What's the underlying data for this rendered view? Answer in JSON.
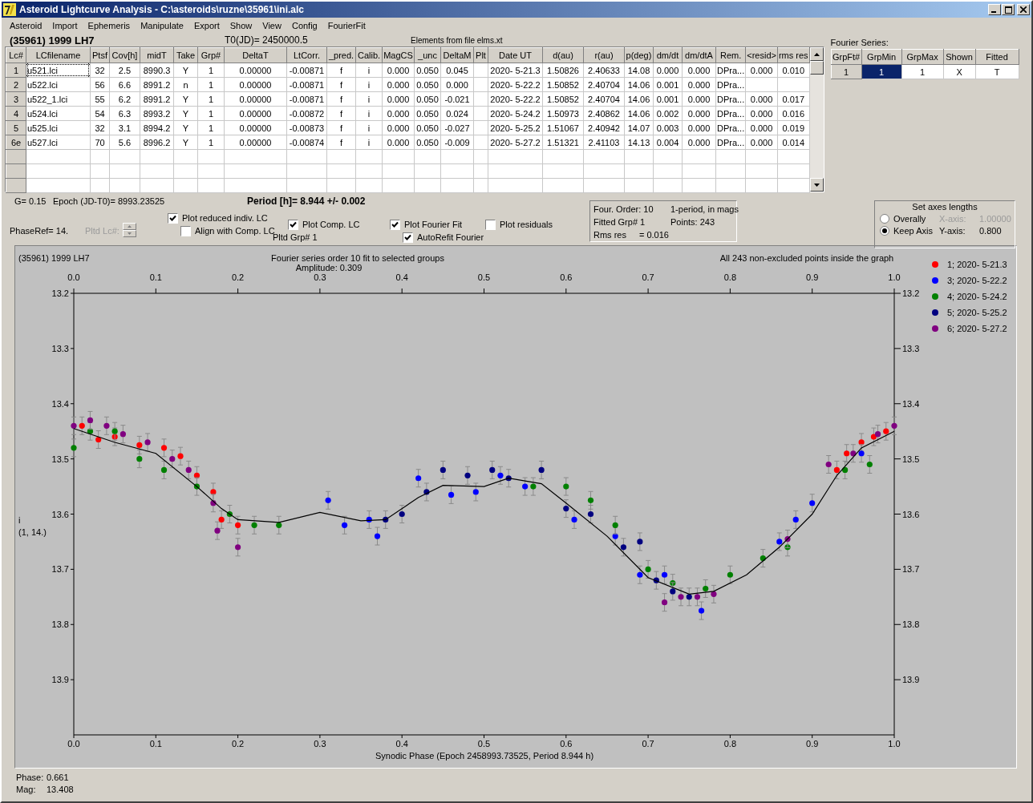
{
  "window": {
    "title": "Asteroid Lightcurve Analysis - C:\\asteroids\\ruzne\\35961\\ini.alc"
  },
  "menu": [
    "Asteroid",
    "Import",
    "Ephemeris",
    "Manipulate",
    "Export",
    "Show",
    "View",
    "Config",
    "FourierFit"
  ],
  "header": {
    "object": "(35961) 1999 LH7",
    "t0": "T0(JD)= 2450000.5",
    "elements": "Elements from file elms.xt"
  },
  "table": {
    "columns": [
      "Lc#",
      "LCfilename",
      "Ptsf",
      "Cov[h]",
      "midT",
      "Take",
      "Grp#",
      "DeltaT",
      "LtCorr.",
      "_pred.",
      "Calib.",
      "MagCS",
      "_unc",
      "DeltaM",
      "Plt",
      "Date UT",
      "d(au)",
      "r(au)",
      "p(deg)",
      "dm/dt",
      "dm/dtA",
      "Rem.",
      "<resid>",
      "rms res"
    ],
    "rows": [
      {
        "cells": [
          "1",
          "u521.lci",
          "32",
          "2.5",
          "8990.3",
          "Y",
          "1",
          "0.00000",
          "-0.00871",
          "f",
          "i",
          "0.000",
          "0.050",
          "0.045",
          null,
          "2020- 5-21.3",
          "1.50826",
          "2.40633",
          "14.08",
          "0.000",
          "0.000",
          "DPra...",
          "0.000",
          "0.010"
        ],
        "focused": true
      },
      {
        "cells": [
          "2",
          "u522.lci",
          "56",
          "6.6",
          "8991.2",
          "n",
          "1",
          "0.00000",
          "-0.00871",
          "f",
          "i",
          "0.000",
          "0.050",
          "0.000",
          null,
          "2020- 5-22.2",
          "1.50852",
          "2.40704",
          "14.06",
          "0.001",
          "0.000",
          "DPra...",
          null,
          null
        ],
        "focused": false
      },
      {
        "cells": [
          "3",
          "u522_1.lci",
          "55",
          "6.2",
          "8991.2",
          "Y",
          "1",
          "0.00000",
          "-0.00871",
          "f",
          "i",
          "0.000",
          "0.050",
          "-0.021",
          null,
          "2020- 5-22.2",
          "1.50852",
          "2.40704",
          "14.06",
          "0.001",
          "0.000",
          "DPra...",
          "0.000",
          "0.017"
        ],
        "focused": false
      },
      {
        "cells": [
          "4",
          "u524.lci",
          "54",
          "6.3",
          "8993.2",
          "Y",
          "1",
          "0.00000",
          "-0.00872",
          "f",
          "i",
          "0.000",
          "0.050",
          "0.024",
          null,
          "2020- 5-24.2",
          "1.50973",
          "2.40862",
          "14.06",
          "0.002",
          "0.000",
          "DPra...",
          "0.000",
          "0.016"
        ],
        "focused": false
      },
      {
        "cells": [
          "5",
          "u525.lci",
          "32",
          "3.1",
          "8994.2",
          "Y",
          "1",
          "0.00000",
          "-0.00873",
          "f",
          "i",
          "0.000",
          "0.050",
          "-0.027",
          null,
          "2020- 5-25.2",
          "1.51067",
          "2.40942",
          "14.07",
          "0.003",
          "0.000",
          "DPra...",
          "0.000",
          "0.019"
        ],
        "focused": false
      },
      {
        "cells": [
          "6e",
          "u527.lci",
          "70",
          "5.6",
          "8996.2",
          "Y",
          "1",
          "0.00000",
          "-0.00874",
          "f",
          "i",
          "0.000",
          "0.050",
          "-0.009",
          null,
          "2020- 5-27.2",
          "1.51321",
          "2.41103",
          "14.13",
          "0.004",
          "0.000",
          "DPra...",
          "0.000",
          "0.014"
        ],
        "focused": false
      }
    ],
    "blank_rows": [
      {
        "kind": "blank"
      },
      {
        "kind": "blank"
      },
      {
        "kind": "blank"
      }
    ]
  },
  "fourier_series": {
    "label": "Fourier Series:",
    "columns": [
      "GrpFt#",
      "GrpMin",
      "GrpMax",
      "Shown",
      "Fitted"
    ],
    "rows": [
      {
        "cells": [
          {
            "text": "1",
            "selected": false
          },
          {
            "text": "1",
            "selected": true
          },
          {
            "text": "1",
            "selected": false
          },
          {
            "text": "X",
            "selected": false
          },
          {
            "text": "T",
            "selected": false
          }
        ]
      }
    ]
  },
  "controls": {
    "g": "G= 0.15",
    "epoch": "Epoch (JD-T0)= 8993.23525",
    "period": "Period [h]= 8.944 +/- 0.002",
    "phase_ref": "PhaseRef= 14.",
    "pltd_lc": {
      "label": "Pltd Lc#:",
      "disabled": true
    },
    "pltd_grp": "Pltd Grp#  1",
    "checkboxes": [
      {
        "label": "Plot reduced indiv. LC",
        "checked": true
      },
      {
        "label": "Align with Comp. LC",
        "checked": false
      },
      {
        "label": "Plot Comp. LC",
        "checked": true
      },
      {
        "label": "Plot Fourier Fit",
        "checked": true
      },
      {
        "label": "AutoRefit Fourier",
        "checked": true
      },
      {
        "label": "Plot residuals",
        "checked": false
      }
    ]
  },
  "fit_summary": {
    "order": "Four. Order: 10",
    "mode": "1-period, in mags",
    "fitted_grp": "Fitted Grp# 1",
    "points": "Points: 243",
    "rms_label": "Rms res",
    "rms_value": "= 0.016"
  },
  "axes_lengths": {
    "title": "Set axes lengths",
    "options": [
      {
        "label": "Overally",
        "selected": false
      },
      {
        "label": "Keep Axis",
        "selected": true
      }
    ],
    "x_axis": {
      "label": "X-axis:",
      "value": "1.00000",
      "disabled": true
    },
    "y_axis": {
      "label": "Y-axis:",
      "value": "0.800",
      "disabled": false
    }
  },
  "plot": {
    "object": "(35961) 1999 LH7",
    "title": "Fourier series order 10 fit to selected groups",
    "amplitude": "Amplitude: 0.309",
    "note": "All 243 non-excluded points inside the graph",
    "ylabel_lines": [
      "i",
      "(1, 14.)"
    ],
    "top_axis_labels": [
      "0.0",
      "0.1",
      "0.2",
      "0.3",
      "0.4",
      "0.5",
      "0.6",
      "0.7",
      "0.8",
      "0.9",
      "1.0"
    ],
    "right_axis_labels": [
      "13.2",
      "13.3",
      "13.4",
      "13.5",
      "13.6",
      "13.7",
      "13.8",
      "13.9"
    ],
    "chart_data": {
      "type": "scatter",
      "legend": "right",
      "xlabel": "Synodic Phase (Epoch 2458993.73525, Period 8.944 h)",
      "xlim": [
        0,
        1
      ],
      "ylim": [
        14.0,
        13.2
      ],
      "xticks": [
        {
          "value": 0,
          "label": "0.0"
        },
        {
          "value": 0.1,
          "label": "0.1"
        },
        {
          "value": 0.2,
          "label": "0.2"
        },
        {
          "value": 0.3,
          "label": "0.3"
        },
        {
          "value": 0.4,
          "label": "0.4"
        },
        {
          "value": 0.5,
          "label": "0.5"
        },
        {
          "value": 0.6,
          "label": "0.6"
        },
        {
          "value": 0.7,
          "label": "0.7"
        },
        {
          "value": 0.8,
          "label": "0.8"
        },
        {
          "value": 0.9,
          "label": "0.9"
        },
        {
          "value": 1,
          "label": "1.0"
        }
      ],
      "yticks": [
        13.2,
        13.3,
        13.4,
        13.5,
        13.6,
        13.7,
        13.8,
        13.9
      ],
      "series": [
        {
          "name": "1; 2020- 5-21.3",
          "color": "#ff0000",
          "x": [
            0.01,
            0.03,
            0.05,
            0.08,
            0.11,
            0.13,
            0.15,
            0.17,
            0.18,
            0.2,
            0.93,
            0.942,
            0.96,
            0.975,
            0.99
          ],
          "values": [
            13.44,
            13.465,
            13.46,
            13.475,
            13.48,
            13.495,
            13.53,
            13.56,
            13.61,
            13.62,
            13.52,
            13.49,
            13.47,
            13.46,
            13.45
          ]
        },
        {
          "name": "3; 2020- 5-22.2",
          "color": "#0000ff",
          "x": [
            0.31,
            0.33,
            0.36,
            0.37,
            0.42,
            0.46,
            0.49,
            0.52,
            0.55,
            0.61,
            0.66,
            0.69,
            0.72,
            0.765,
            0.86,
            0.88,
            0.9,
            0.96
          ],
          "values": [
            13.575,
            13.62,
            13.61,
            13.64,
            13.535,
            13.565,
            13.56,
            13.53,
            13.55,
            13.61,
            13.64,
            13.71,
            13.71,
            13.775,
            13.65,
            13.61,
            13.58,
            13.49
          ]
        },
        {
          "name": "4; 2020- 5-24.2",
          "color": "#008000",
          "x": [
            0.0,
            0.02,
            0.05,
            0.08,
            0.11,
            0.15,
            0.19,
            0.22,
            0.25,
            0.56,
            0.6,
            0.63,
            0.66,
            0.7,
            0.73,
            0.77,
            0.8,
            0.84,
            0.87,
            0.94,
            0.97
          ],
          "values": [
            13.48,
            13.45,
            13.45,
            13.5,
            13.52,
            13.55,
            13.6,
            13.62,
            13.62,
            13.55,
            13.55,
            13.575,
            13.62,
            13.7,
            13.725,
            13.735,
            13.71,
            13.68,
            13.66,
            13.52,
            13.51
          ]
        },
        {
          "name": "5; 2020- 5-25.2",
          "color": "#000080",
          "x": [
            0.38,
            0.4,
            0.43,
            0.45,
            0.48,
            0.51,
            0.53,
            0.57,
            0.6,
            0.63,
            0.67,
            0.69,
            0.71,
            0.73,
            0.75
          ],
          "values": [
            13.61,
            13.6,
            13.56,
            13.52,
            13.53,
            13.52,
            13.535,
            13.52,
            13.59,
            13.6,
            13.66,
            13.65,
            13.72,
            13.74,
            13.75
          ]
        },
        {
          "name": "6; 2020- 5-27.2",
          "color": "#800080",
          "x": [
            0.0,
            0.02,
            0.04,
            0.06,
            0.09,
            0.12,
            0.14,
            0.17,
            0.175,
            0.2,
            0.72,
            0.74,
            0.76,
            0.78,
            0.87,
            0.92,
            0.95,
            0.98,
            1.0
          ],
          "values": [
            13.44,
            13.43,
            13.44,
            13.455,
            13.47,
            13.5,
            13.52,
            13.58,
            13.63,
            13.66,
            13.76,
            13.75,
            13.75,
            13.745,
            13.645,
            13.51,
            13.49,
            13.455,
            13.44
          ]
        },
        {
          "type": "line",
          "color": "#000000",
          "x": [
            0,
            0.05,
            0.1,
            0.15,
            0.18,
            0.2,
            0.25,
            0.3,
            0.35,
            0.38,
            0.42,
            0.45,
            0.5,
            0.53,
            0.57,
            0.6,
            0.65,
            0.7,
            0.75,
            0.78,
            0.82,
            0.86,
            0.9,
            0.93,
            0.96,
            1.0
          ],
          "values": [
            13.445,
            13.47,
            13.49,
            13.55,
            13.59,
            13.61,
            13.615,
            13.597,
            13.612,
            13.61,
            13.57,
            13.548,
            13.55,
            13.535,
            13.545,
            13.58,
            13.64,
            13.715,
            13.745,
            13.74,
            13.71,
            13.66,
            13.6,
            13.53,
            13.48,
            13.45
          ]
        }
      ]
    }
  },
  "status": {
    "phase_label": "Phase:",
    "phase_value": "0.661",
    "mag_label": "Mag:",
    "mag_value": "13.408"
  }
}
